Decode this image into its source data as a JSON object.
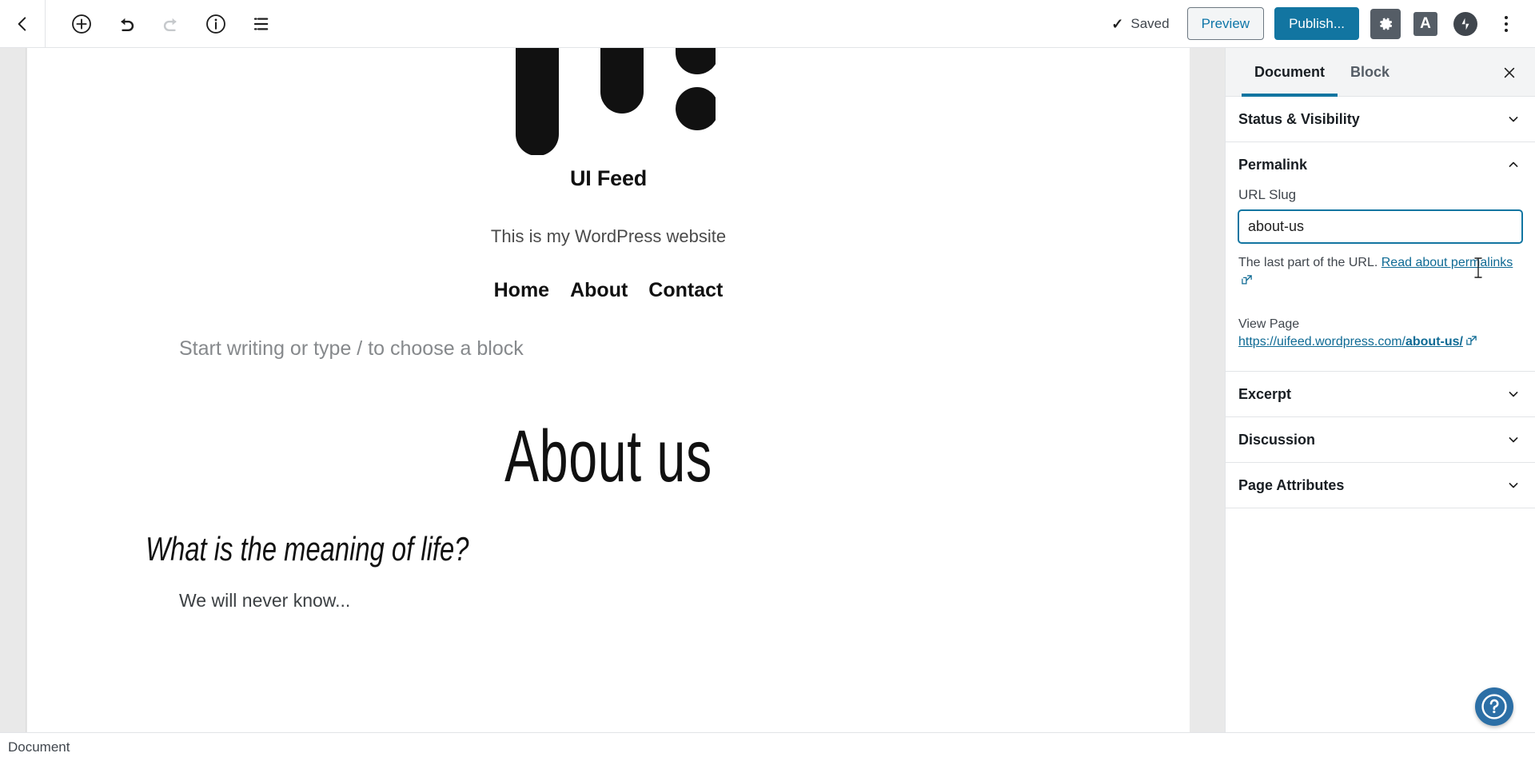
{
  "toolbar": {
    "back_icon": "chevron-left-icon",
    "add_block_icon": "plus-circle-icon",
    "undo_icon": "undo-arrow-icon",
    "redo_icon": "redo-arrow-icon",
    "info_icon": "info-circle-icon",
    "block_navigation_icon": "list-view-icon",
    "saved_check": "✓",
    "saved_label": "Saved",
    "preview_label": "Preview",
    "publish_label": "Publish...",
    "settings_icon": "gear-icon",
    "letter_a_icon": "A",
    "jetpack_icon": "jetpack-icon",
    "more_menu_icon": "kebab-menu-icon",
    "publish_color": "#1275a1",
    "preview_text_color": "#0e76a8"
  },
  "site_preview": {
    "logo_alt": "ui-feed-logo",
    "title": "UI Feed",
    "tagline": "This is my WordPress website",
    "nav": [
      {
        "label": "Home"
      },
      {
        "label": "About"
      },
      {
        "label": "Contact"
      }
    ],
    "block_placeholder": "Start writing or type / to choose a block",
    "page_title": "About us",
    "sub_heading": "What is the meaning of life?",
    "body_paragraph": "We will never know..."
  },
  "sidebar": {
    "tabs": [
      {
        "label": "Document",
        "active": true
      },
      {
        "label": "Block",
        "active": false
      }
    ],
    "close_icon": "close-icon",
    "panels": [
      {
        "title": "Status & Visibility",
        "expanded": false,
        "chevron": "chevron-down-icon"
      },
      {
        "title": "Permalink",
        "expanded": true,
        "chevron": "chevron-up-icon"
      },
      {
        "title": "Excerpt",
        "expanded": false,
        "chevron": "chevron-down-icon"
      },
      {
        "title": "Discussion",
        "expanded": false,
        "chevron": "chevron-down-icon"
      },
      {
        "title": "Page Attributes",
        "expanded": false,
        "chevron": "chevron-down-icon"
      }
    ],
    "permalink": {
      "slug_label": "URL Slug",
      "slug_value": "about-us",
      "slug_placeholder": "about-us",
      "help_prefix": "The last part of the URL. ",
      "help_link": "Read about permalinks",
      "external_link_icon": "external-link-icon",
      "view_page_label": "View Page",
      "view_url_base": "https://uifeed.wordpress.com/",
      "view_url_slug": "about-us/",
      "link_color": "#0e6a94"
    }
  },
  "help_fab": {
    "icon": "help-circle-icon",
    "color": "#2c6fa6"
  },
  "status_bar": {
    "label": "Document"
  }
}
